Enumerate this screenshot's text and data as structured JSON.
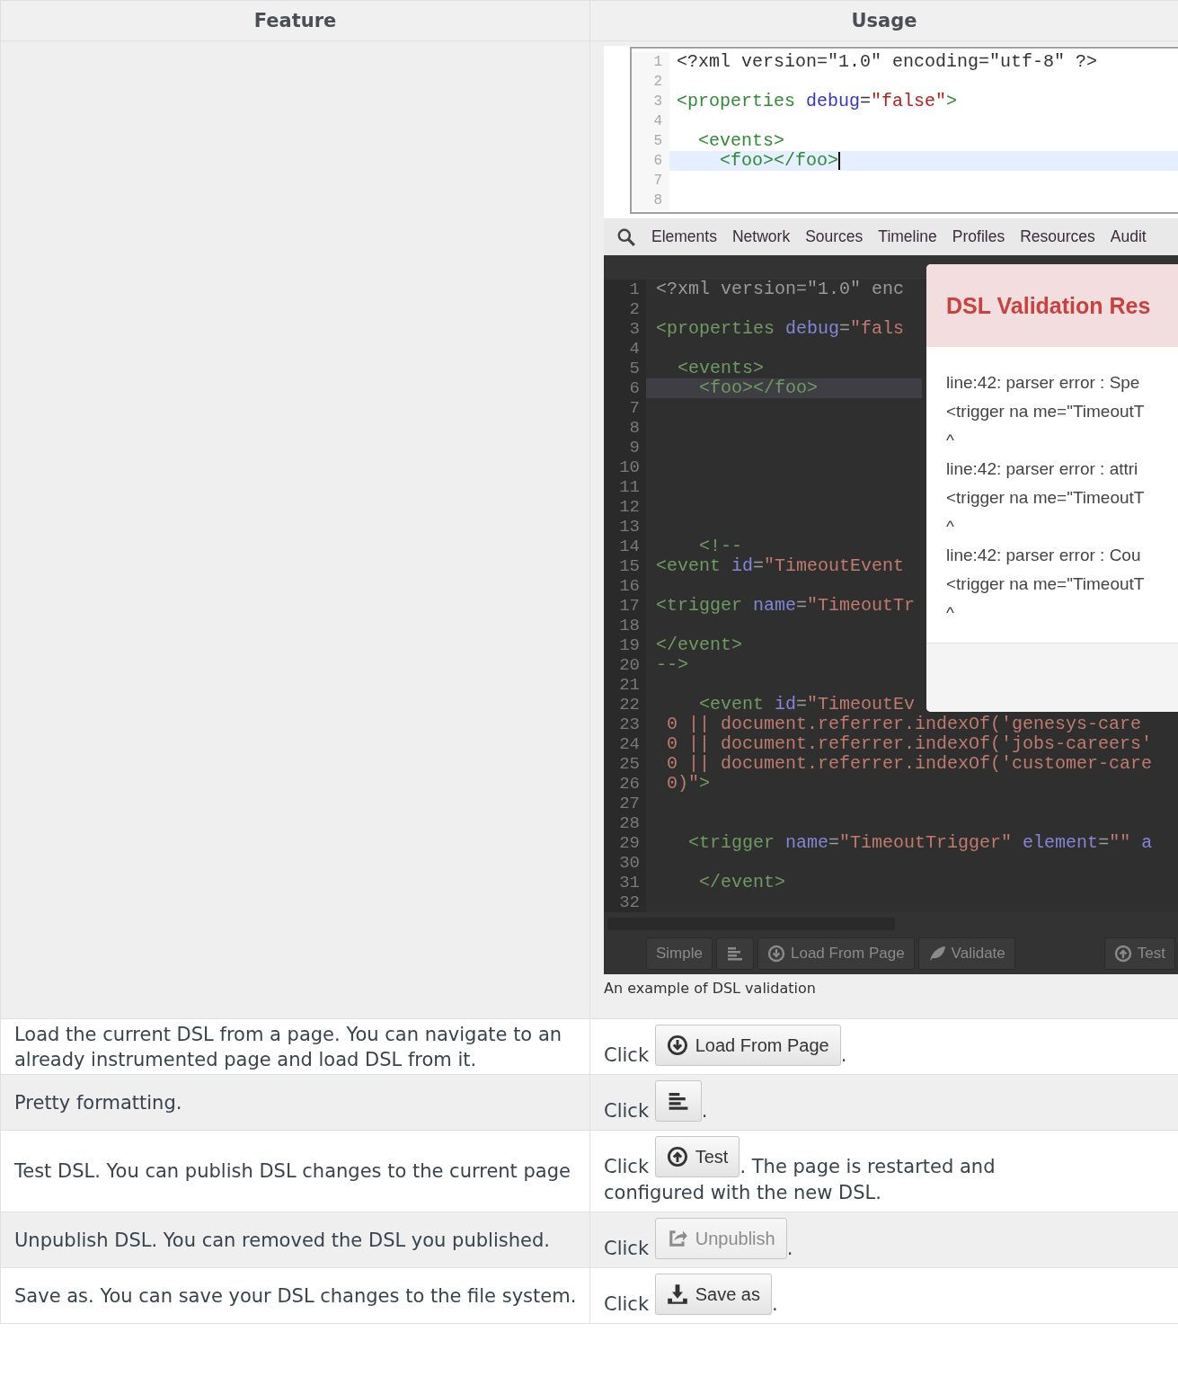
{
  "table": {
    "columns": [
      "Feature",
      "Usage"
    ],
    "rows": [
      {
        "usage": {
          "figure": {
            "editor": {
              "lines": [
                {
                  "number": "1",
                  "highlighted": false,
                  "tokens": [
                    {
                      "kind": "text",
                      "text": "<?xml version=\"1.0\" encoding=\"utf-8\" ?>"
                    }
                  ]
                },
                {
                  "number": "2",
                  "highlighted": false
                },
                {
                  "number": "3",
                  "highlighted": false,
                  "tokens": [
                    {
                      "kind": "tag",
                      "text": "<properties "
                    },
                    {
                      "kind": "attr",
                      "text": "debug"
                    },
                    {
                      "kind": "text",
                      "text": "="
                    },
                    {
                      "kind": "value",
                      "text": "\"false\""
                    },
                    {
                      "kind": "tag",
                      "text": ">"
                    }
                  ]
                },
                {
                  "number": "4",
                  "highlighted": false
                },
                {
                  "number": "5",
                  "highlighted": false,
                  "tokens": [
                    {
                      "kind": "tag",
                      "text": "  <events>"
                    }
                  ]
                },
                {
                  "number": "6",
                  "highlighted": true,
                  "tokens": [
                    {
                      "kind": "tag",
                      "text": "    <foo></foo>"
                    }
                  ]
                },
                {
                  "number": "7",
                  "highlighted": false
                },
                {
                  "number": "8",
                  "highlighted": false
                }
              ]
            },
            "devtools_tabs": [
              "Elements",
              "Network",
              "Sources",
              "Timeline",
              "Profiles",
              "Resources",
              "Audit"
            ],
            "dark_editor": {
              "lines": [
                {
                  "number": "1",
                  "highlighted": false,
                  "tokens": [
                    {
                      "kind": "text",
                      "text": "<?xml version=\"1.0\" enc"
                    }
                  ]
                },
                {
                  "number": "2",
                  "highlighted": false
                },
                {
                  "number": "3",
                  "highlighted": false,
                  "tokens": [
                    {
                      "kind": "tag",
                      "text": "<properties "
                    },
                    {
                      "kind": "attr",
                      "text": "debug"
                    },
                    {
                      "kind": "text",
                      "text": "="
                    },
                    {
                      "kind": "value",
                      "text": "\"fals"
                    }
                  ]
                },
                {
                  "number": "4",
                  "highlighted": false
                },
                {
                  "number": "5",
                  "highlighted": false,
                  "tokens": [
                    {
                      "kind": "tag",
                      "text": "  <events>"
                    }
                  ]
                },
                {
                  "number": "6",
                  "highlighted": true,
                  "tokens": [
                    {
                      "kind": "tag",
                      "text": "    <foo></foo>"
                    }
                  ]
                },
                {
                  "number": "7",
                  "highlighted": false
                },
                {
                  "number": "8",
                  "highlighted": false
                },
                {
                  "number": "9",
                  "highlighted": false
                },
                {
                  "number": "10",
                  "highlighted": false
                },
                {
                  "number": "11",
                  "highlighted": false
                },
                {
                  "number": "12",
                  "highlighted": false
                },
                {
                  "number": "13",
                  "highlighted": false
                },
                {
                  "number": "14",
                  "highlighted": false,
                  "tokens": [
                    {
                      "kind": "tag",
                      "text": "    <!--"
                    }
                  ]
                },
                {
                  "number": "15",
                  "highlighted": false,
                  "tokens": [
                    {
                      "kind": "tag",
                      "text": "<event "
                    },
                    {
                      "kind": "attr",
                      "text": "id"
                    },
                    {
                      "kind": "text",
                      "text": "="
                    },
                    {
                      "kind": "value",
                      "text": "\"TimeoutEvent"
                    }
                  ]
                },
                {
                  "number": "16",
                  "highlighted": false
                },
                {
                  "number": "17",
                  "highlighted": false,
                  "tokens": [
                    {
                      "kind": "tag",
                      "text": "<trigger "
                    },
                    {
                      "kind": "attr",
                      "text": "name"
                    },
                    {
                      "kind": "text",
                      "text": "="
                    },
                    {
                      "kind": "value",
                      "text": "\"TimeoutTr"
                    }
                  ]
                },
                {
                  "number": "18",
                  "highlighted": false
                },
                {
                  "number": "19",
                  "highlighted": false,
                  "tokens": [
                    {
                      "kind": "tag",
                      "text": "</event>"
                    }
                  ]
                },
                {
                  "number": "20",
                  "highlighted": false,
                  "tokens": [
                    {
                      "kind": "tag",
                      "text": "-->"
                    }
                  ]
                },
                {
                  "number": "21",
                  "highlighted": false
                },
                {
                  "number": "22",
                  "highlighted": false,
                  "tokens": [
                    {
                      "kind": "tag",
                      "text": "    <event "
                    },
                    {
                      "kind": "attr",
                      "text": "id"
                    },
                    {
                      "kind": "text",
                      "text": "="
                    },
                    {
                      "kind": "value",
                      "text": "\"TimeoutEv"
                    }
                  ]
                },
                {
                  "number": "23",
                  "highlighted": false,
                  "tokens": [
                    {
                      "kind": "value",
                      "text": " 0 || document.referrer.indexOf('genesys-care"
                    }
                  ]
                },
                {
                  "number": "24",
                  "highlighted": false,
                  "tokens": [
                    {
                      "kind": "value",
                      "text": " 0 || document.referrer.indexOf('jobs-careers'"
                    }
                  ]
                },
                {
                  "number": "25",
                  "highlighted": false,
                  "tokens": [
                    {
                      "kind": "value",
                      "text": " 0 || document.referrer.indexOf('customer-care"
                    }
                  ]
                },
                {
                  "number": "26",
                  "highlighted": false,
                  "tokens": [
                    {
                      "kind": "value",
                      "text": " 0)\""
                    },
                    {
                      "kind": "tag",
                      "text": ">"
                    }
                  ]
                },
                {
                  "number": "27",
                  "highlighted": false
                },
                {
                  "number": "28",
                  "highlighted": false
                },
                {
                  "number": "29",
                  "highlighted": false,
                  "tokens": [
                    {
                      "kind": "tag",
                      "text": "   <trigger "
                    },
                    {
                      "kind": "attr",
                      "text": "name"
                    },
                    {
                      "kind": "text",
                      "text": "="
                    },
                    {
                      "kind": "value",
                      "text": "\"TimeoutTrigger\" "
                    },
                    {
                      "kind": "attr",
                      "text": "element"
                    },
                    {
                      "kind": "text",
                      "text": "="
                    },
                    {
                      "kind": "value",
                      "text": "\"\""
                    },
                    {
                      "kind": "attr",
                      "text": " a"
                    }
                  ]
                },
                {
                  "number": "30",
                  "highlighted": false
                },
                {
                  "number": "31",
                  "highlighted": false,
                  "tokens": [
                    {
                      "kind": "tag",
                      "text": "    </event>"
                    }
                  ]
                },
                {
                  "number": "32",
                  "highlighted": false
                }
              ]
            },
            "dialog": {
              "title": "DSL Validation Res",
              "messages": [
                "line:42: parser error : Spe",
                "<trigger na me=\"TimeoutT",
                "^",
                "line:42: parser error : attri",
                "<trigger na me=\"TimeoutT",
                "^",
                "line:42: parser error : Cou",
                "<trigger na me=\"TimeoutT",
                "^"
              ]
            },
            "toolbar": [
              {
                "kind": "text",
                "label": "Simple"
              },
              {
                "kind": "format"
              },
              {
                "kind": "load",
                "label": "Load From Page"
              },
              {
                "kind": "validate",
                "label": "Validate"
              },
              {
                "kind": "test",
                "label": "Test"
              }
            ]
          },
          "caption": "An example of DSL validation"
        }
      },
      {
        "feature": "Load the current DSL from a page. You can navigate to an already instrumented page and load DSL from it.",
        "usage": {
          "prefix": "Click",
          "button": {
            "kind": "load",
            "label": "Load From Page",
            "disabled": false
          },
          "suffix": "."
        }
      },
      {
        "feature": "Pretty formatting.",
        "usage": {
          "prefix": "Click",
          "button": {
            "kind": "format",
            "disabled": false
          },
          "suffix": "."
        }
      },
      {
        "feature": "Test DSL. You can publish DSL changes to the current page",
        "usage": {
          "prefix": "Click",
          "button": {
            "kind": "test",
            "label": "Test",
            "disabled": false
          },
          "suffix": ". The page is restarted and configured with the new DSL."
        }
      },
      {
        "feature": "Unpublish DSL. You can removed the DSL you published.",
        "usage": {
          "prefix": "Click",
          "button": {
            "kind": "unpublish",
            "label": "Unpublish",
            "disabled": true
          },
          "suffix": "."
        }
      },
      {
        "feature": "Save as. You can save your DSL changes to the file system.",
        "usage": {
          "prefix": "Click",
          "button": {
            "kind": "save",
            "label": "Save as",
            "disabled": false
          },
          "suffix": "."
        }
      }
    ]
  }
}
